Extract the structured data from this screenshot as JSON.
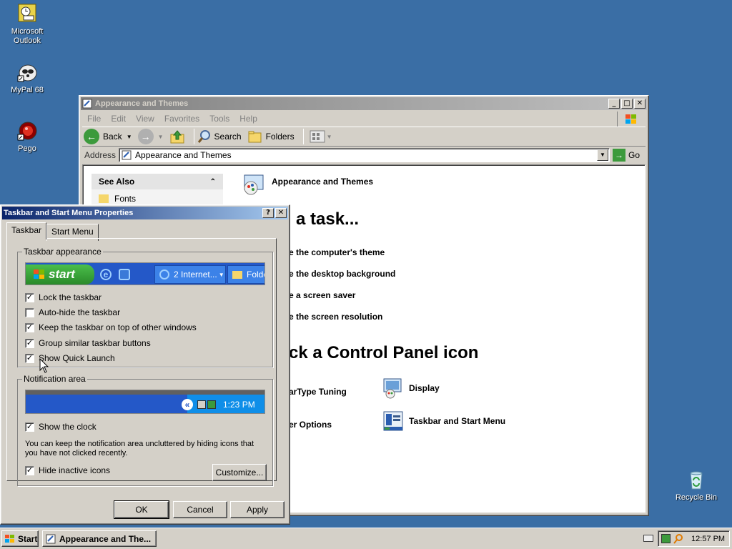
{
  "desktop": {
    "icons": [
      {
        "label": "Microsoft Outlook",
        "icon": "outlook-icon"
      },
      {
        "label": "MyPal 68",
        "icon": "mypal-icon"
      },
      {
        "label": "Pego",
        "icon": "pego-icon"
      },
      {
        "label": "Recycle Bin",
        "icon": "recycle-bin-icon"
      }
    ]
  },
  "explorer": {
    "title": "Appearance and Themes",
    "menu": [
      "File",
      "Edit",
      "View",
      "Favorites",
      "Tools",
      "Help"
    ],
    "toolbar": {
      "back": "Back",
      "search": "Search",
      "folders": "Folders"
    },
    "address_label": "Address",
    "address_value": "Appearance and Themes",
    "go": "Go",
    "see_also": {
      "header": "See Also",
      "items": [
        "Fonts"
      ]
    },
    "heading": "Appearance and Themes",
    "pick_task": "a task...",
    "tasks": [
      "e the computer's theme",
      "e the desktop background",
      "e a screen saver",
      "e the screen resolution"
    ],
    "pick_icon": "ck a Control Panel icon",
    "icons": [
      {
        "label": "arType Tuning"
      },
      {
        "label": "Display"
      },
      {
        "label": "er Options"
      },
      {
        "label": "Taskbar and Start Menu"
      }
    ]
  },
  "dialog": {
    "title": "Taskbar and Start Menu Properties",
    "tabs": [
      "Taskbar",
      "Start Menu"
    ],
    "appearance_group": "Taskbar appearance",
    "preview": {
      "start": "start",
      "item1": "2 Internet...",
      "item2": "Folde"
    },
    "options": [
      {
        "label": "Lock the taskbar",
        "checked": true
      },
      {
        "label": "Auto-hide the taskbar",
        "checked": false
      },
      {
        "label": "Keep the taskbar on top of other windows",
        "checked": true
      },
      {
        "label": "Group similar taskbar buttons",
        "checked": true
      },
      {
        "label": "Show Quick Launch",
        "checked": true
      }
    ],
    "notification_group": "Notification area",
    "tray_time": "1:23 PM",
    "show_clock": {
      "label": "Show the clock",
      "checked": true
    },
    "info_text": "You can keep the notification area uncluttered by hiding icons that you have not clicked recently.",
    "hide_inactive": {
      "label": "Hide inactive icons",
      "checked": true
    },
    "customize": "Customize...",
    "ok": "OK",
    "cancel": "Cancel",
    "apply": "Apply"
  },
  "taskbar": {
    "start": "Start",
    "task": "Appearance and The...",
    "clock": "12:57 PM"
  }
}
